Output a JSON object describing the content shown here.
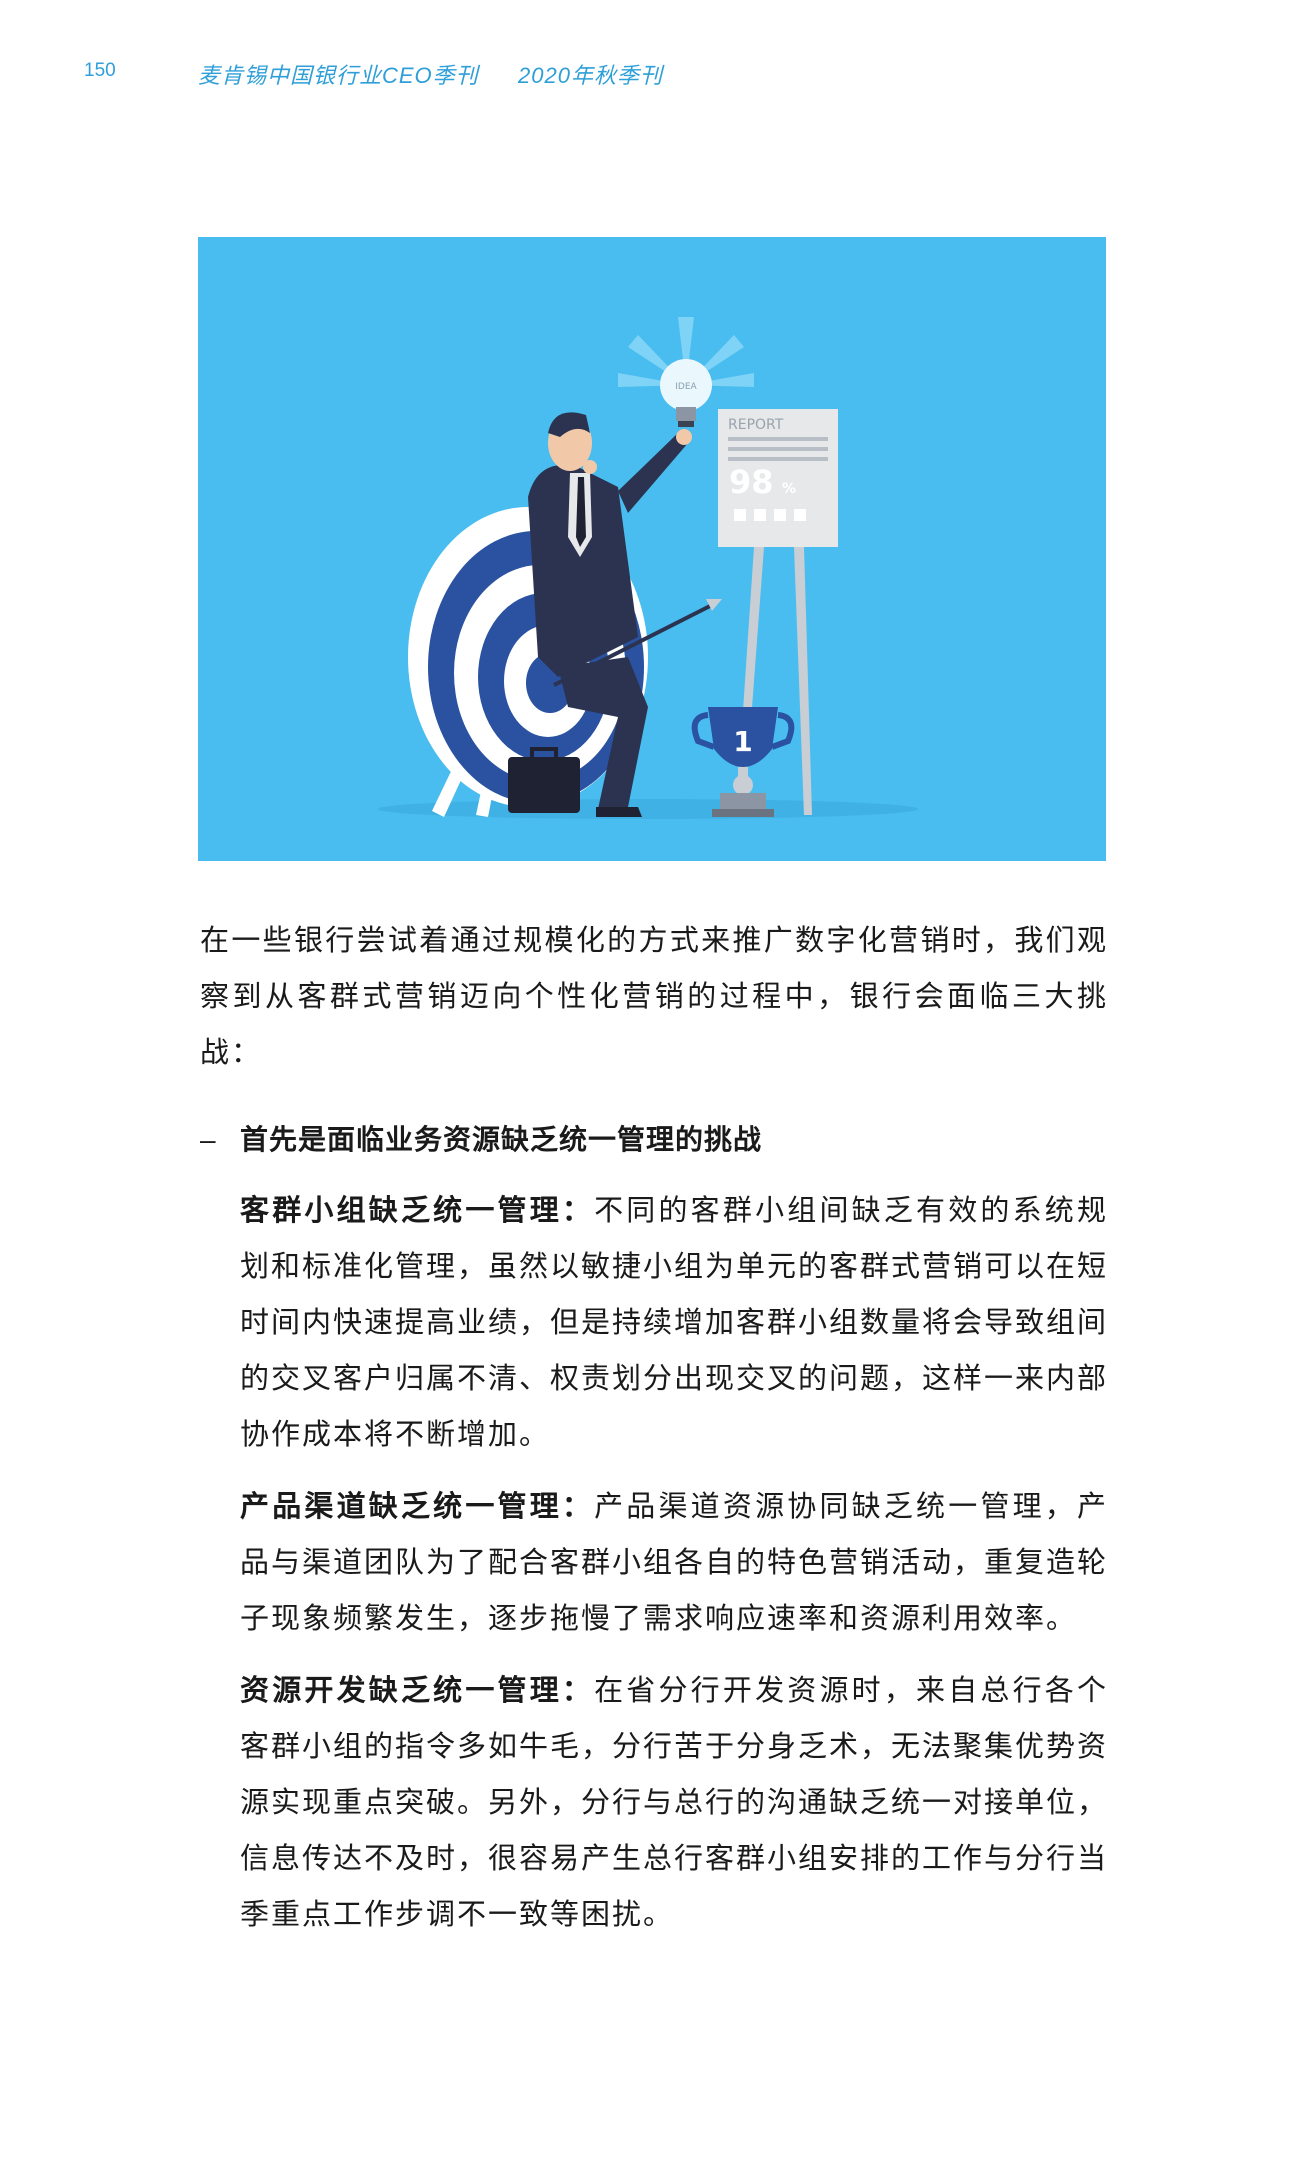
{
  "header": {
    "page_number": "150",
    "publication": "麦肯锡中国银行业CEO季刊",
    "issue": "2020年秋季刊"
  },
  "illustration": {
    "bulb_text": "IDEA",
    "report_title": "REPORT",
    "report_value": "98",
    "report_unit": "%",
    "trophy_number": "1",
    "colors": {
      "background": "#49bdf0",
      "target": "#2a52a0",
      "suit": "#2b3350"
    }
  },
  "body": {
    "intro": "在一些银行尝试着通过规模化的方式来推广数字化营销时，我们观察到从客群式营销迈向个性化营销的过程中，银行会面临三大挑战：",
    "challenge": {
      "dash": "–",
      "title": "首先是面临业务资源缺乏统一管理的挑战",
      "items": [
        {
          "head": "客群小组缺乏统一管理：",
          "text": "不同的客群小组间缺乏有效的系统规划和标准化管理，虽然以敏捷小组为单元的客群式营销可以在短时间内快速提高业绩，但是持续增加客群小组数量将会导致组间的交叉客户归属不清、权责划分出现交叉的问题，这样一来内部协作成本将不断增加。"
        },
        {
          "head": "产品渠道缺乏统一管理：",
          "text": "产品渠道资源协同缺乏统一管理，产品与渠道团队为了配合客群小组各自的特色营销活动，重复造轮子现象频繁发生，逐步拖慢了需求响应速率和资源利用效率。"
        },
        {
          "head": "资源开发缺乏统一管理：",
          "text": "在省分行开发资源时，来自总行各个客群小组的指令多如牛毛，分行苦于分身乏术，无法聚集优势资源实现重点突破。另外，分行与总行的沟通缺乏统一对接单位，信息传达不及时，很容易产生总行客群小组安排的工作与分行当季重点工作步调不一致等困扰。"
        }
      ]
    }
  }
}
